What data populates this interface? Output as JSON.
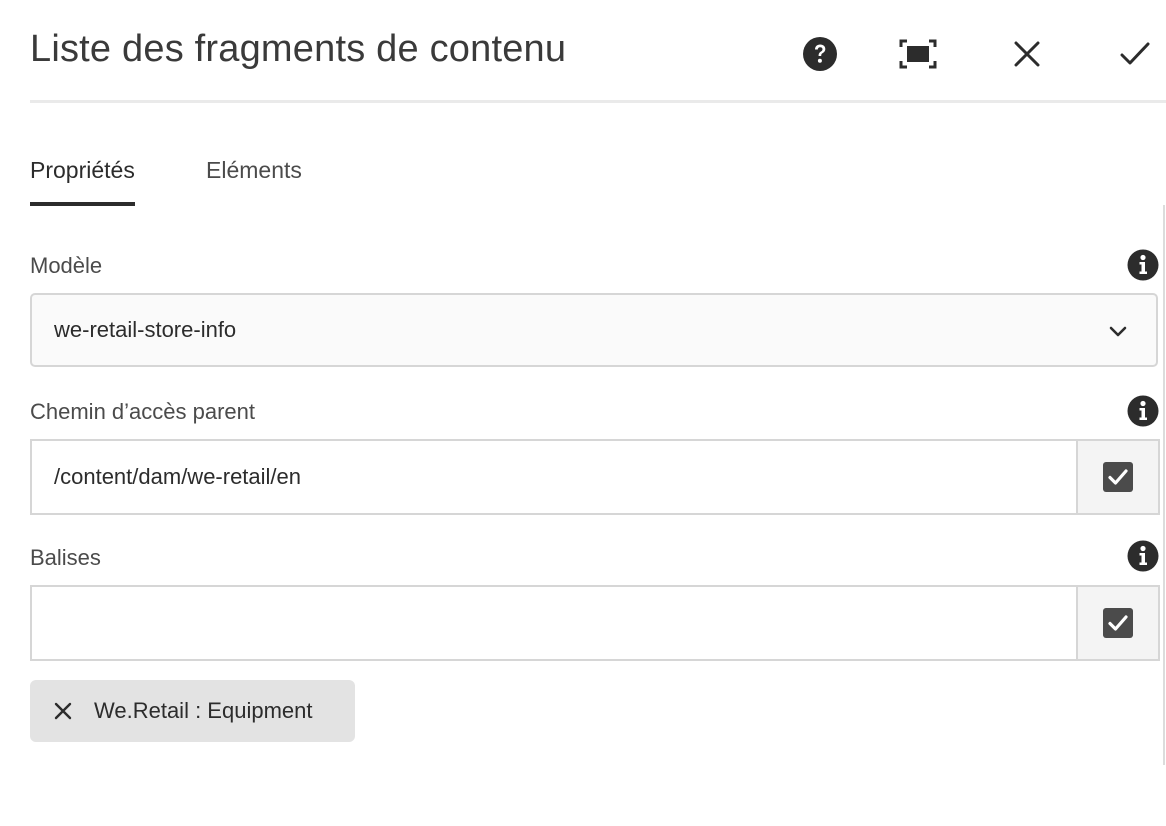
{
  "header": {
    "title": "Liste des fragments de contenu",
    "actions": [
      {
        "name": "help-icon"
      },
      {
        "name": "fullscreen-icon"
      },
      {
        "name": "close-icon"
      },
      {
        "name": "checkmark-icon"
      }
    ]
  },
  "tabs": [
    {
      "label": "Propriétés",
      "active": true
    },
    {
      "label": "Eléments",
      "active": false
    }
  ],
  "fields": {
    "model": {
      "label": "Modèle",
      "value": "we-retail-store-info",
      "icon": "info-icon"
    },
    "parent_path": {
      "label": "Chemin d’accès parent",
      "value": "/content/dam/we-retail/en",
      "icon": "info-icon"
    },
    "tags": {
      "label": "Balises",
      "value": "",
      "icon": "info-icon",
      "selected": [
        {
          "label": "We.Retail : Equipment"
        }
      ]
    }
  },
  "colors": {
    "text": "#2c2c2c",
    "border": "#d6d6d6",
    "tag_bg": "#e3e3e3",
    "icon_dark": "#2c2c2c",
    "picker_icon": "#4b4b4b"
  }
}
